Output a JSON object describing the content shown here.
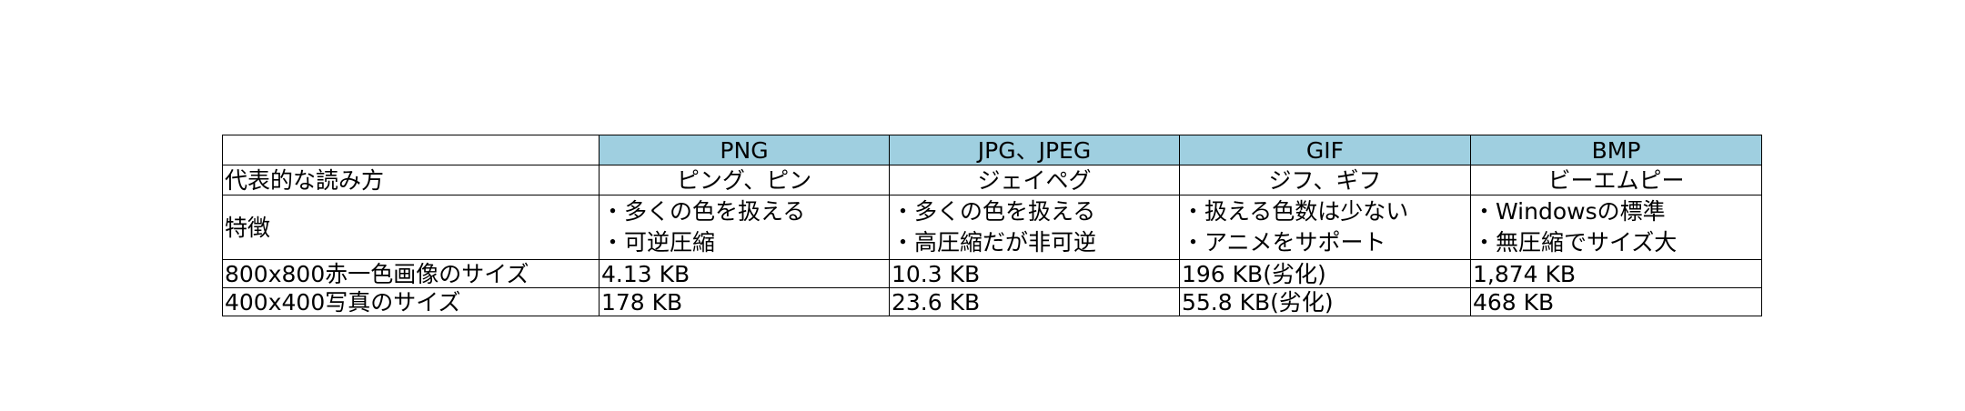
{
  "table": {
    "formats": [
      "PNG",
      "JPG、JPEG",
      "GIF",
      "BMP"
    ],
    "rows": {
      "reading": {
        "label": "代表的な読み方",
        "values": [
          "ピング、ピン",
          "ジェイペグ",
          "ジフ、ギフ",
          "ビーエムピー"
        ]
      },
      "features": {
        "label": "特徴",
        "values": [
          [
            "・多くの色を扱える",
            "・可逆圧縮"
          ],
          [
            "・多くの色を扱える",
            "・高圧縮だが非可逆"
          ],
          [
            "・扱える色数は少ない",
            "・アニメをサポート"
          ],
          [
            "・Windowsの標準",
            "・無圧縮でサイズ大"
          ]
        ]
      },
      "size_800": {
        "label": "800x800赤一色画像のサイズ",
        "values": [
          "4.13 KB",
          "10.3 KB",
          "196 KB(劣化)",
          "1,874 KB"
        ]
      },
      "size_400": {
        "label": "400x400写真のサイズ",
        "values": [
          "178 KB",
          "23.6 KB",
          "55.8 KB(劣化)",
          "468 KB"
        ]
      }
    }
  },
  "colors": {
    "header_fill": "#9fcfe0",
    "border": "#000000",
    "text": "#000000"
  }
}
